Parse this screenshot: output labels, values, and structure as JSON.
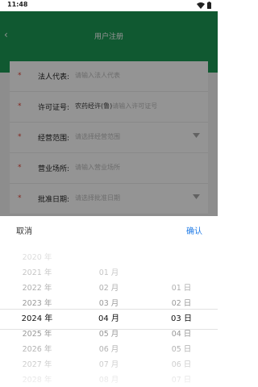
{
  "status_bar": {
    "time": "11:48"
  },
  "header": {
    "back_icon": "back-chevron-icon",
    "title": "用户注册"
  },
  "form": {
    "required_mark": "*",
    "rows": [
      {
        "label": "法人代表:",
        "value": "",
        "placeholder": "请输入法人代表",
        "dropdown": false
      },
      {
        "label": "许可证号:",
        "value": "农药经许(鲁)",
        "placeholder": "请输入许可证号",
        "dropdown": false
      },
      {
        "label": "经营范围:",
        "value": "",
        "placeholder": "请选择经营范围",
        "dropdown": true
      },
      {
        "label": "营业场所:",
        "value": "",
        "placeholder": "请输入营业场所",
        "dropdown": false
      },
      {
        "label": "批准日期:",
        "value": "",
        "placeholder": "请选择批准日期",
        "dropdown": true
      }
    ]
  },
  "date_picker": {
    "cancel_label": "取消",
    "confirm_label": "确认",
    "years": [
      "2020 年",
      "2021 年",
      "2022 年",
      "2023 年",
      "2024 年",
      "2025 年",
      "2026 年",
      "2027 年",
      "2028 年"
    ],
    "months": [
      "01 月",
      "02 月",
      "03 月",
      "04 月",
      "05 月",
      "06 月",
      "07 月",
      "08 月"
    ],
    "days": [
      "01 日",
      "02 日",
      "03 日",
      "04 日",
      "05 日",
      "06 日",
      "07 日"
    ],
    "selected": {
      "year": "2024 年",
      "month": "04 月",
      "day": "03 日"
    }
  },
  "colors": {
    "header": "#1d9a55",
    "required": "#e34234",
    "confirm": "#1e7ae6"
  }
}
